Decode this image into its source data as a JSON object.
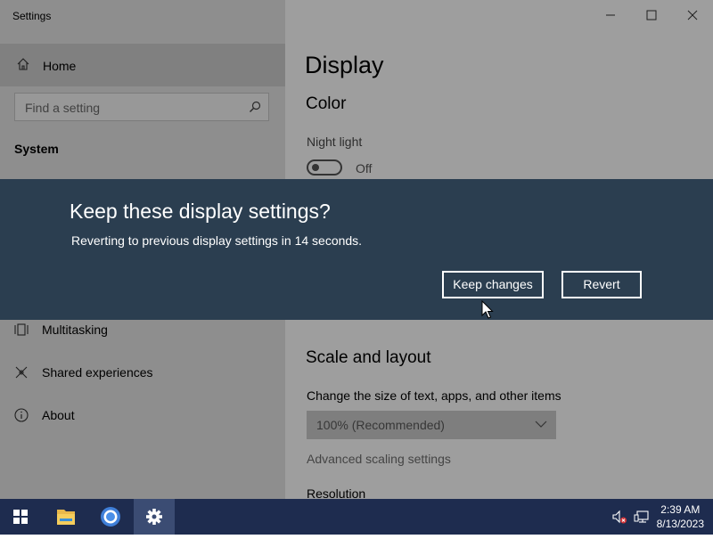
{
  "window": {
    "title": "Settings"
  },
  "sidebar": {
    "home_label": "Home",
    "search_placeholder": "Find a setting",
    "section_title": "System",
    "items": [
      {
        "label": "Multitasking",
        "icon": "multitasking-icon"
      },
      {
        "label": "Shared experiences",
        "icon": "shared-experiences-icon"
      },
      {
        "label": "About",
        "icon": "info-icon"
      }
    ]
  },
  "main": {
    "title": "Display",
    "color_heading": "Color",
    "night_light_label": "Night light",
    "night_light_state": "Off",
    "scale_heading": "Scale and layout",
    "size_label": "Change the size of text, apps, and other items",
    "size_value": "100% (Recommended)",
    "advanced_link": "Advanced scaling settings",
    "resolution_label": "Resolution"
  },
  "dialog": {
    "title": "Keep these display settings?",
    "message": "Reverting to previous display settings in 14 seconds.",
    "keep_label": "Keep changes",
    "revert_label": "Revert"
  },
  "taskbar": {
    "time": "2:39 AM",
    "date": "8/13/2023",
    "apps": [
      "start-icon",
      "file-explorer-icon",
      "chrome-icon",
      "settings-icon"
    ]
  },
  "colors": {
    "dialog_bg": "#2b3e50",
    "taskbar_bg": "#1e2c4f",
    "sidebar_bg": "#e6e6e6"
  }
}
